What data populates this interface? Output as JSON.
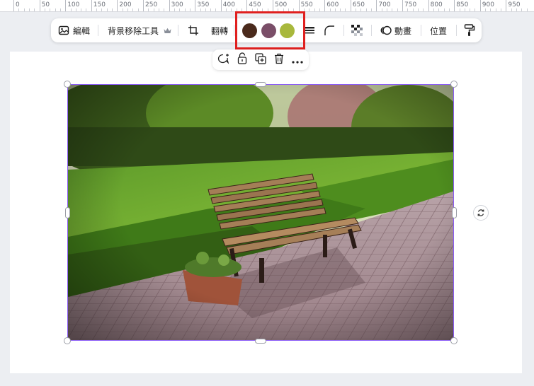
{
  "ruler": {
    "labels": [
      "0",
      "50",
      "100",
      "150",
      "200",
      "250",
      "300",
      "350",
      "400",
      "450",
      "500",
      "550",
      "600",
      "650",
      "700",
      "750",
      "800",
      "850",
      "900",
      "950"
    ]
  },
  "toolbar": {
    "edit_label": "編輯",
    "bg_remover_label": "背景移除工具",
    "flip_label": "翻轉",
    "animate_label": "動畫",
    "position_label": "位置",
    "colors": [
      "#4a2a1c",
      "#7a4e68",
      "#a8b83c"
    ],
    "highlight_color": "#e0201f"
  },
  "icons": {
    "edit": "image-edit-icon",
    "premium": "crown-icon",
    "crop": "crop-icon",
    "border": "border-style-icon",
    "corner": "corner-radius-icon",
    "transparency": "transparency-icon",
    "animate": "animate-icon",
    "paint": "paint-roller-icon",
    "comment": "comment-add-icon",
    "lock": "lock-icon",
    "duplicate": "duplicate-icon",
    "delete": "trash-icon",
    "more": "more-icon",
    "rotate": "rotate-icon"
  }
}
